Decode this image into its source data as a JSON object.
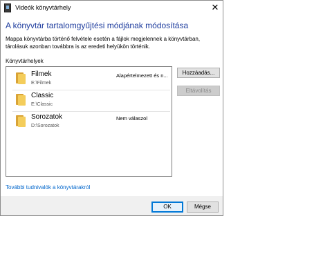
{
  "window": {
    "title": "Videók könyvtárhely",
    "close_glyph": "✕",
    "app_icon": "video-library-icon"
  },
  "heading": "A könyvtár tartalomgyűjtési módjának módosítása",
  "description": "Mappa könyvtárba történő felvétele esetén a fájlok megjelennek a könyvtárban, tárolásuk azonban továbbra is az eredeti helyükön történik.",
  "locations_label": "Könyvtárhelyek",
  "folders": [
    {
      "name": "Filmek",
      "path": "E:\\Filmek",
      "status": "Alapértelmezett és n...",
      "icon": "folder-icon"
    },
    {
      "name": "Classic",
      "path": "E:\\Classic",
      "status": "",
      "icon": "folder-icon"
    },
    {
      "name": "Sorozatok",
      "path": "D:\\Sorozatok",
      "status": "Nem válaszol",
      "icon": "folder-icon"
    }
  ],
  "buttons": {
    "add": "Hozzáadás...",
    "remove": "Eltávolítás",
    "ok": "OK",
    "cancel": "Mégse"
  },
  "more_info_link": "További tudnivalók a könyvtárakról",
  "colors": {
    "heading": "#1f3d9e",
    "link": "#0066cc",
    "default_button_border": "#0078d7",
    "folder": "#f4cd5b"
  }
}
